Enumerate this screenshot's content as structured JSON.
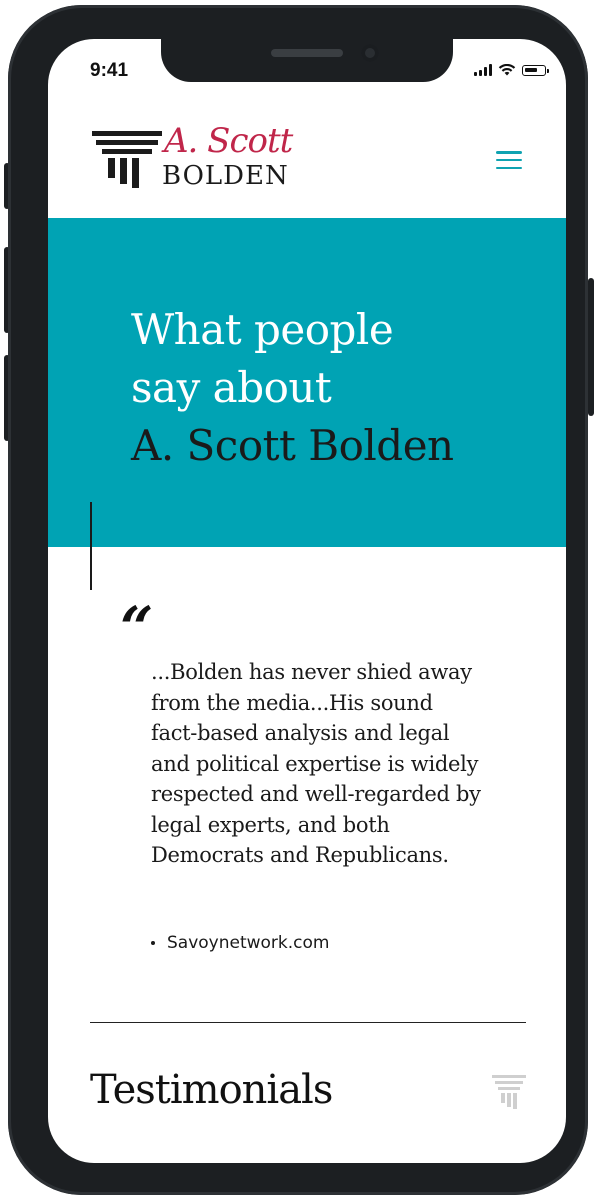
{
  "status_bar": {
    "time": "9:41"
  },
  "header": {
    "logo": {
      "script_text": "A. Scott",
      "name_text": "BOLDEN"
    },
    "menu_icon": "hamburger-menu-icon"
  },
  "hero": {
    "title_line1": "What people",
    "title_line2": "say about",
    "title_line3": "A. Scott Bolden"
  },
  "quote": {
    "mark": "“",
    "text": "...Bolden has never shied away from the media...His sound fact-based analysis and legal and political expertise is widely respected and well-regarded by legal experts, and both Democrats and Republicans.",
    "source": "Savoynetwork.com"
  },
  "section": {
    "title": "Testimonials"
  },
  "colors": {
    "accent_teal": "#00a3b4",
    "logo_red": "#c0264a",
    "text_dark": "#1a1a1a"
  }
}
